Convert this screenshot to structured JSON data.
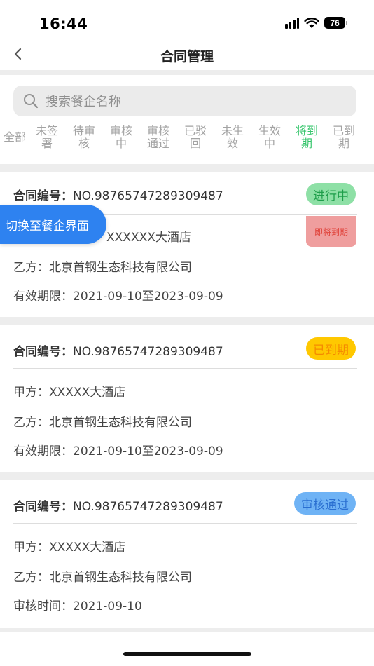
{
  "status_bar": {
    "time": "16:44",
    "battery": "76"
  },
  "nav": {
    "title": "合同管理",
    "back_icon": "chevron-left-icon"
  },
  "search": {
    "placeholder": "搜索餐企名称"
  },
  "filter_tabs": [
    {
      "label": "全部",
      "active": false
    },
    {
      "label": "未签署",
      "active": false
    },
    {
      "label": "待审核",
      "active": false
    },
    {
      "label": "审核中",
      "active": false
    },
    {
      "label": "审核通过",
      "active": false
    },
    {
      "label": "已驳回",
      "active": false
    },
    {
      "label": "未生效",
      "active": false
    },
    {
      "label": "生效中",
      "active": false
    },
    {
      "label": "将到期",
      "active": true
    },
    {
      "label": "已到期",
      "active": false
    }
  ],
  "floating_button": {
    "label": "切换至餐企界面"
  },
  "cards": [
    {
      "contract_label": "合同编号：",
      "contract_no": "NO.98765747289309487",
      "status": "进行中",
      "status_bg": "#8ee0a6",
      "status_color": "#1e9e4a",
      "expire_tag": "即将到期",
      "party_a": "甲方：XXXXX大酒店",
      "party_a_visible": "XXXXXX大酒店",
      "party_b": "乙方：北京首钢生态科技有限公司",
      "validity": "有效期限：2021-09-10至2023-09-09"
    },
    {
      "contract_label": "合同编号：",
      "contract_no": "NO.98765747289309487",
      "status": "已到期",
      "status_bg": "#ffc800",
      "status_color": "#f58a00",
      "party_a": "甲方：XXXXX大酒店",
      "party_b": "乙方：北京首钢生态科技有限公司",
      "validity": "有效期限：2021-09-10至2023-09-09"
    },
    {
      "contract_label": "合同编号：",
      "contract_no": "NO.98765747289309487",
      "status": "审核通过",
      "status_bg": "#6fb3f5",
      "status_color": "#2a6fd1",
      "party_a": "甲方：XXXXX大酒店",
      "party_b": "乙方：北京首钢生态科技有限公司",
      "review_time": "审核时间：2021-09-10"
    }
  ]
}
